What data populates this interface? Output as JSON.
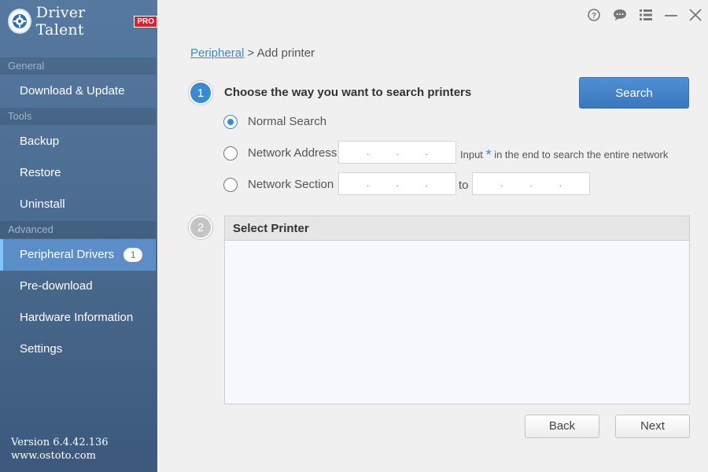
{
  "app": {
    "name": "Driver Talent",
    "badge": "PRO"
  },
  "sidebar": {
    "sections": [
      {
        "header": "General",
        "items": [
          {
            "label": "Download & Update"
          }
        ]
      },
      {
        "header": "Tools",
        "items": [
          {
            "label": "Backup"
          },
          {
            "label": "Restore"
          },
          {
            "label": "Uninstall"
          }
        ]
      },
      {
        "header": "Advanced",
        "items": [
          {
            "label": "Peripheral Drivers",
            "badge": "1",
            "active": true
          },
          {
            "label": "Pre-download"
          },
          {
            "label": "Hardware Information"
          },
          {
            "label": "Settings"
          }
        ]
      }
    ],
    "version_label": "Version",
    "version": "6.4.42.136",
    "website": "www.ostoto.com"
  },
  "window_controls": [
    "help-icon",
    "feedback-icon",
    "menu-icon",
    "minimize-icon",
    "close-icon"
  ],
  "breadcrumb": {
    "parent": "Peripheral",
    "separator": ">",
    "current": "Add printer"
  },
  "step1": {
    "number": "1",
    "title": "Choose the way you want to search printers",
    "search_button": "Search",
    "options": {
      "normal": {
        "label": "Normal Search",
        "selected": true
      },
      "network_address": {
        "label": "Network Address",
        "ip_placeholder": ". . .",
        "hint_prefix": "Input",
        "hint_star": "*",
        "hint_suffix": "in the end to search the entire network"
      },
      "network_section": {
        "label": "Network Section",
        "to_label": "to"
      }
    }
  },
  "step2": {
    "number": "2",
    "title": "Select Printer"
  },
  "buttons": {
    "back": "Back",
    "next": "Next"
  },
  "colors": {
    "accent": "#3a8ad0",
    "sidebar": "#4b6c91",
    "active_item": "#5b8dc7"
  }
}
